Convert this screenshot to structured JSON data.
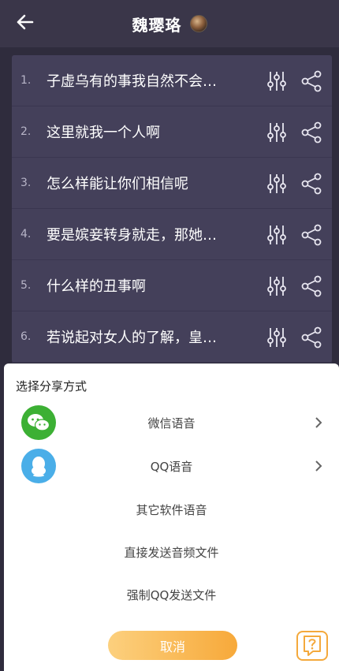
{
  "header": {
    "title": "魏璎珞"
  },
  "list": {
    "items": [
      {
        "num": "1.",
        "text": "子虚乌有的事我自然不会…"
      },
      {
        "num": "2.",
        "text": "这里就我一个人啊"
      },
      {
        "num": "3.",
        "text": "怎么样能让你们相信呢"
      },
      {
        "num": "4.",
        "text": "要是嫔妾转身就走，那她…"
      },
      {
        "num": "5.",
        "text": "什么样的丑事啊"
      },
      {
        "num": "6.",
        "text": "若说起对女人的了解，皇…"
      }
    ]
  },
  "share_sheet": {
    "title": "选择分享方式",
    "options": [
      {
        "label": "微信语音",
        "icon": "wechat-icon"
      },
      {
        "label": "QQ语音",
        "icon": "qq-icon"
      },
      {
        "label": "其它软件语音"
      },
      {
        "label": "直接发送音频文件"
      },
      {
        "label": "强制QQ发送文件"
      }
    ],
    "cancel_label": "取消"
  },
  "colors": {
    "background": "#2f2c3d",
    "header": "#3a3649",
    "list_bg": "#44405a",
    "wechat": "#3cb034",
    "qq": "#4aaee8",
    "accent": "#f7a93a"
  }
}
